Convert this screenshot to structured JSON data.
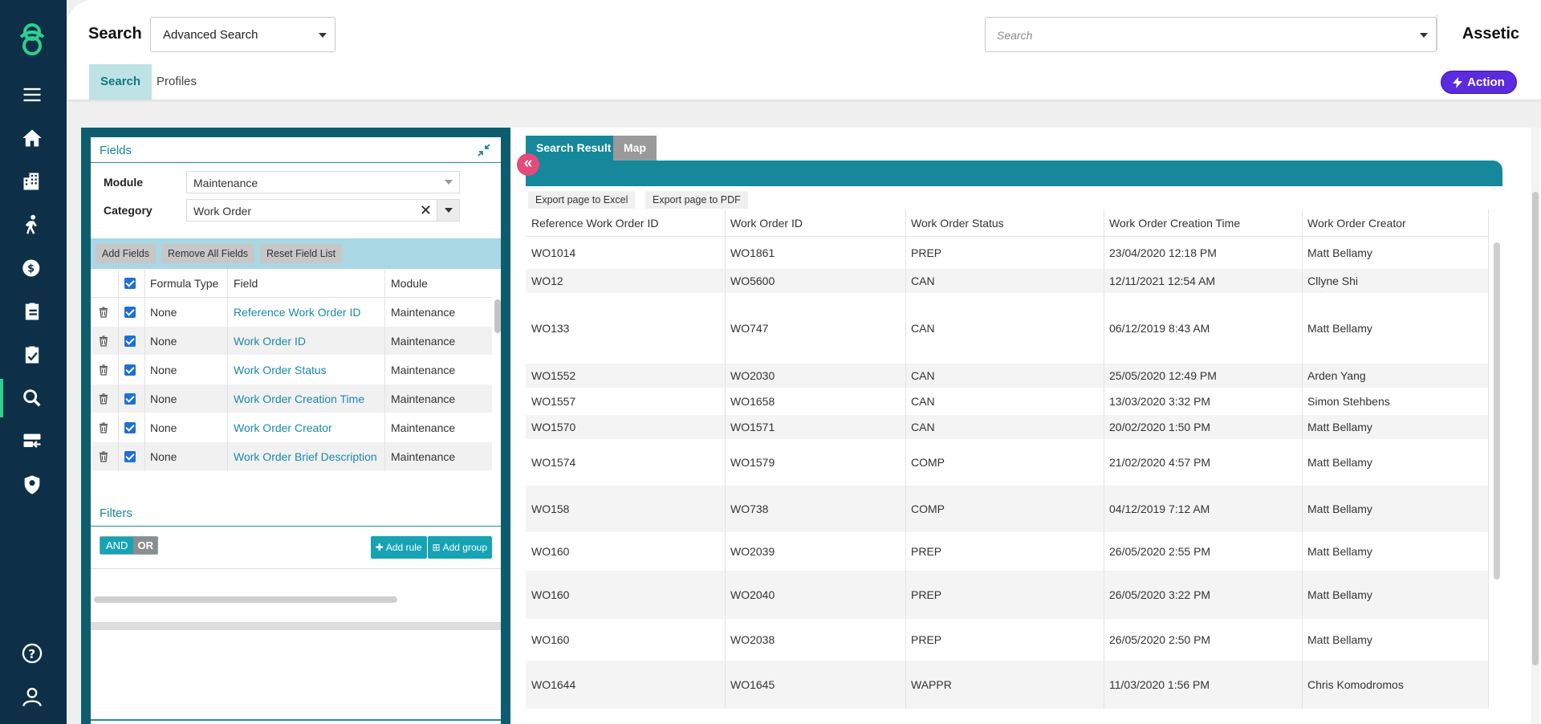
{
  "header": {
    "title": "Search",
    "search_type": "Advanced Search",
    "search_placeholder": "Search",
    "brand": "Assetic"
  },
  "subnav": {
    "tabs": [
      "Search",
      "Profiles"
    ],
    "action_label": "Action"
  },
  "fields_panel": {
    "title": "Fields",
    "module_label": "Module",
    "module_value": "Maintenance",
    "category_label": "Category",
    "category_value": "Work Order",
    "buttons": [
      "Add Fields",
      "Remove All Fields",
      "Reset Field List"
    ],
    "columns": [
      "Formula Type",
      "Field",
      "Module"
    ],
    "rows": [
      {
        "formula": "None",
        "field": "Reference Work Order ID",
        "module": "Maintenance"
      },
      {
        "formula": "None",
        "field": "Work Order ID",
        "module": "Maintenance"
      },
      {
        "formula": "None",
        "field": "Work Order Status",
        "module": "Maintenance"
      },
      {
        "formula": "None",
        "field": "Work Order Creation Time",
        "module": "Maintenance"
      },
      {
        "formula": "None",
        "field": "Work Order Creator",
        "module": "Maintenance"
      },
      {
        "formula": "None",
        "field": "Work Order Brief Description",
        "module": "Maintenance"
      }
    ]
  },
  "filters_panel": {
    "title": "Filters",
    "and_label": "AND",
    "or_label": "OR",
    "add_rule": "Add rule",
    "add_group": "Add group"
  },
  "results": {
    "tabs": [
      "Search Result",
      "Map"
    ],
    "export_excel": "Export page to Excel",
    "export_pdf": "Export page to PDF",
    "columns": [
      "Reference Work Order ID",
      "Work Order ID",
      "Work Order Status",
      "Work Order Creation Time",
      "Work Order Creator"
    ],
    "rows": [
      {
        "ref": "WO1014",
        "id": "WO1861",
        "status": "PREP",
        "time": "23/04/2020 12:18 PM",
        "creator": "Matt Bellamy"
      },
      {
        "ref": "WO12",
        "id": "WO5600",
        "status": "CAN",
        "time": "12/11/2021 12:54 AM",
        "creator": "Cllyne Shi"
      },
      {
        "ref": "WO133",
        "id": "WO747",
        "status": "CAN",
        "time": "06/12/2019 8:43 AM",
        "creator": "Matt Bellamy"
      },
      {
        "ref": "WO1552",
        "id": "WO2030",
        "status": "CAN",
        "time": "25/05/2020 12:49 PM",
        "creator": "Arden Yang"
      },
      {
        "ref": "WO1557",
        "id": "WO1658",
        "status": "CAN",
        "time": "13/03/2020 3:32 PM",
        "creator": "Simon Stehbens"
      },
      {
        "ref": "WO1570",
        "id": "WO1571",
        "status": "CAN",
        "time": "20/02/2020 1:50 PM",
        "creator": "Matt Bellamy"
      },
      {
        "ref": "WO1574",
        "id": "WO1579",
        "status": "COMP",
        "time": "21/02/2020 4:57 PM",
        "creator": "Matt Bellamy"
      },
      {
        "ref": "WO158",
        "id": "WO738",
        "status": "COMP",
        "time": "04/12/2019 7:12 AM",
        "creator": "Matt Bellamy"
      },
      {
        "ref": "WO160",
        "id": "WO2039",
        "status": "PREP",
        "time": "26/05/2020 2:55 PM",
        "creator": "Matt Bellamy"
      },
      {
        "ref": "WO160",
        "id": "WO2040",
        "status": "PREP",
        "time": "26/05/2020 3:22 PM",
        "creator": "Matt Bellamy"
      },
      {
        "ref": "WO160",
        "id": "WO2038",
        "status": "PREP",
        "time": "26/05/2020 2:50 PM",
        "creator": "Matt Bellamy"
      },
      {
        "ref": "WO1644",
        "id": "WO1645",
        "status": "WAPPR",
        "time": "11/03/2020 1:56 PM",
        "creator": "Chris Komodromos"
      }
    ]
  },
  "nav_icons": [
    "menu-icon",
    "home-icon",
    "buildings-icon",
    "worker-icon",
    "finance-icon",
    "clipboard-icon",
    "task-icon",
    "search-icon",
    "data-import-icon",
    "security-icon",
    "help-icon",
    "user-icon"
  ],
  "colors": {
    "nav_bg": "#0d3048",
    "teal": "#15889b",
    "action": "#5b2be0",
    "accent": "#2ecf8f"
  }
}
